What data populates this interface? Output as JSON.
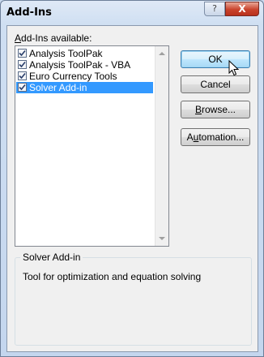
{
  "window": {
    "title": "Add-Ins"
  },
  "titlebar_buttons": {
    "help": "?",
    "close": "X"
  },
  "list": {
    "label_prefix": "",
    "label_accel": "A",
    "label_rest": "dd-Ins available:",
    "items": [
      {
        "label": "Analysis ToolPak",
        "checked": true,
        "selected": false
      },
      {
        "label": "Analysis ToolPak - VBA",
        "checked": true,
        "selected": false
      },
      {
        "label": "Euro Currency Tools",
        "checked": true,
        "selected": false
      },
      {
        "label": "Solver Add-in",
        "checked": true,
        "selected": true
      }
    ]
  },
  "buttons": {
    "ok": "OK",
    "cancel": "Cancel",
    "browse_accel": "B",
    "browse_rest": "rowse...",
    "automation_pre": "A",
    "automation_accel": "u",
    "automation_rest": "tomation..."
  },
  "details": {
    "title": "Solver Add-in",
    "description": "Tool for optimization and equation solving"
  },
  "colors": {
    "selection": "#3399ff",
    "close_button": "#c9432c",
    "dialog_bg": "#f0f0f0"
  },
  "icons": {
    "check": "checkmark-icon",
    "scroll_up": "scroll-up-arrow-icon",
    "scroll_down": "scroll-down-arrow-icon",
    "cursor": "mouse-pointer-icon"
  }
}
